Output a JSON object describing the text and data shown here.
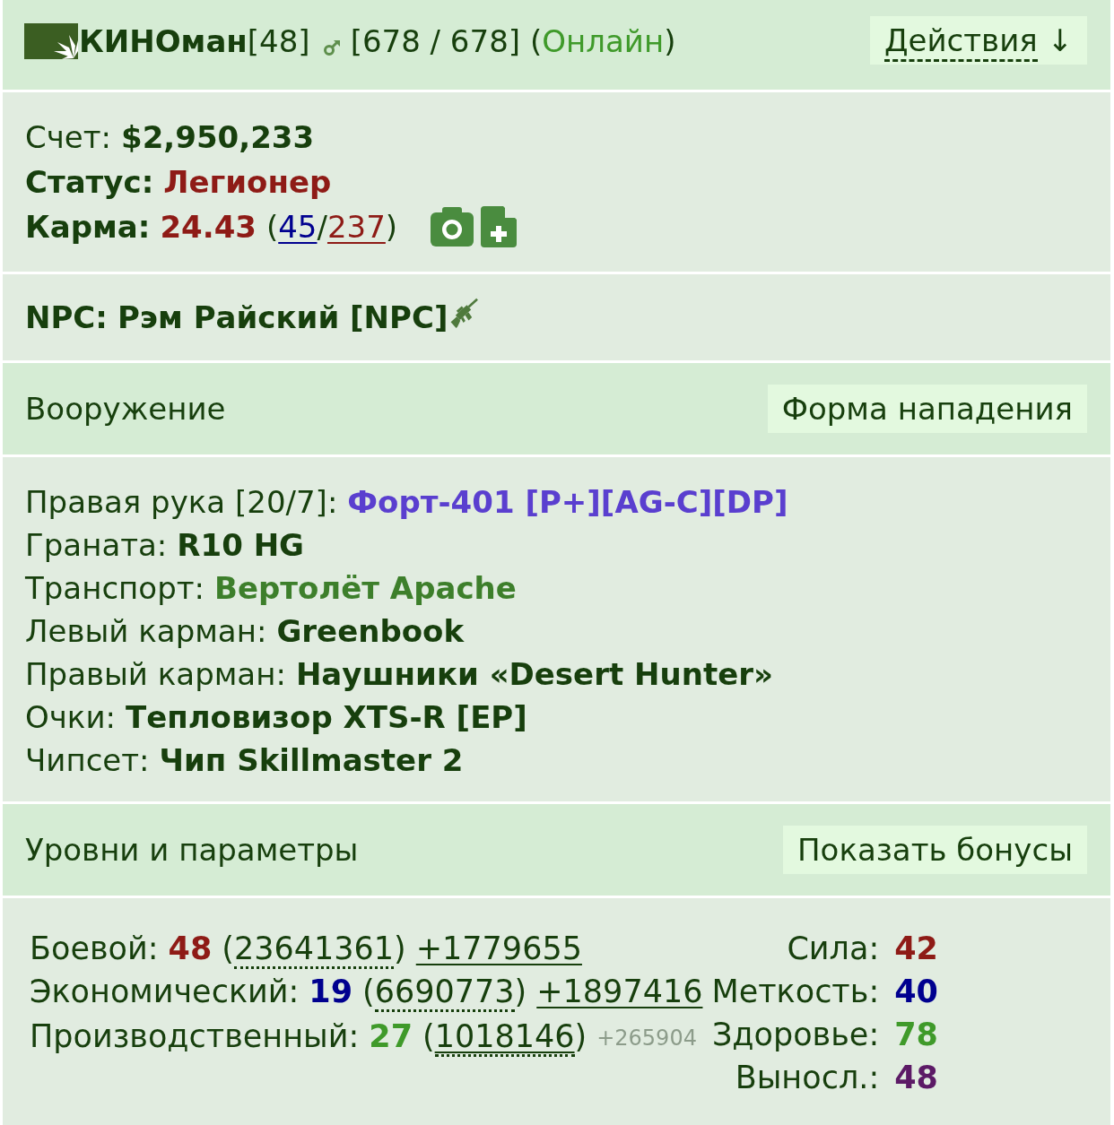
{
  "header": {
    "name": "КИНОман",
    "level": "[48]",
    "health": "[678 / 678]",
    "presence": {
      "open": "(",
      "label": "Онлайн",
      "close": ")"
    },
    "actions_button": {
      "label": "Действия",
      "arrow": "↓"
    }
  },
  "profile": {
    "account": {
      "label": "Счет:",
      "value": "$2,950,233"
    },
    "status": {
      "label": "Статус:",
      "value": "Легионер"
    },
    "karma": {
      "label": "Карма:",
      "value": "24.43",
      "votes": {
        "open": "(",
        "plus": "45",
        "separator": "/",
        "minus": "237",
        "close": ")"
      }
    }
  },
  "npc": {
    "label": "NPC:",
    "name": "Рэм Райский [NPC]"
  },
  "weapons_section": {
    "title": "Вооружение",
    "button": "Форма нападения"
  },
  "equipment": [
    {
      "slot": "Правая рука [20/7]:",
      "item": "Форт-401 [P+][AG-C][DP]",
      "color": "#5a3fcf"
    },
    {
      "slot": "Граната:",
      "item": "R10 HG",
      "color": "#173f0d"
    },
    {
      "slot": "Транспорт:",
      "item": "Вертолёт Apache",
      "color": "#3d7f2b"
    },
    {
      "slot": "Левый карман:",
      "item": "Greenbook",
      "color": "#173f0d"
    },
    {
      "slot": "Правый карман:",
      "item": "Наушники «Desert Hunter»",
      "color": "#173f0d"
    },
    {
      "slot": "Очки:",
      "item": "Тепловизор XTS-R [EP]",
      "color": "#173f0d"
    },
    {
      "slot": "Чипсет:",
      "item": "Чип Skillmaster 2",
      "color": "#173f0d"
    }
  ],
  "levels_section": {
    "title": "Уровни и параметры",
    "button": "Показать бонусы"
  },
  "skills": [
    {
      "label": "Боевой:",
      "level": "48",
      "color": "#8e1b16",
      "experience": {
        "open": "(",
        "value": "23641361",
        "close": ")",
        "linked": false
      },
      "gain": {
        "kind": "link",
        "text": "+1779655"
      }
    },
    {
      "label": "Экономический:",
      "level": "19",
      "color": "#00008f",
      "experience": {
        "open": "(",
        "value": "6690773",
        "close": ")",
        "linked": false
      },
      "gain": {
        "kind": "link",
        "text": "+1897416"
      }
    },
    {
      "label": "Производственный:",
      "level": "27",
      "color": "#3f9a2a",
      "experience": {
        "open": "(",
        "value": "1018146",
        "close": ")",
        "linked": true
      },
      "gain": {
        "kind": "note",
        "text": "+265904"
      }
    }
  ],
  "attributes": [
    {
      "label": "Сила:",
      "value": "42",
      "color": "#8e1b16"
    },
    {
      "label": "Меткость:",
      "value": "40",
      "color": "#00008f"
    },
    {
      "label": "Здоровье:",
      "value": "78",
      "color": "#3f9a2a"
    },
    {
      "label": "Выносл.:",
      "value": "48",
      "color": "#5c1a66"
    }
  ]
}
